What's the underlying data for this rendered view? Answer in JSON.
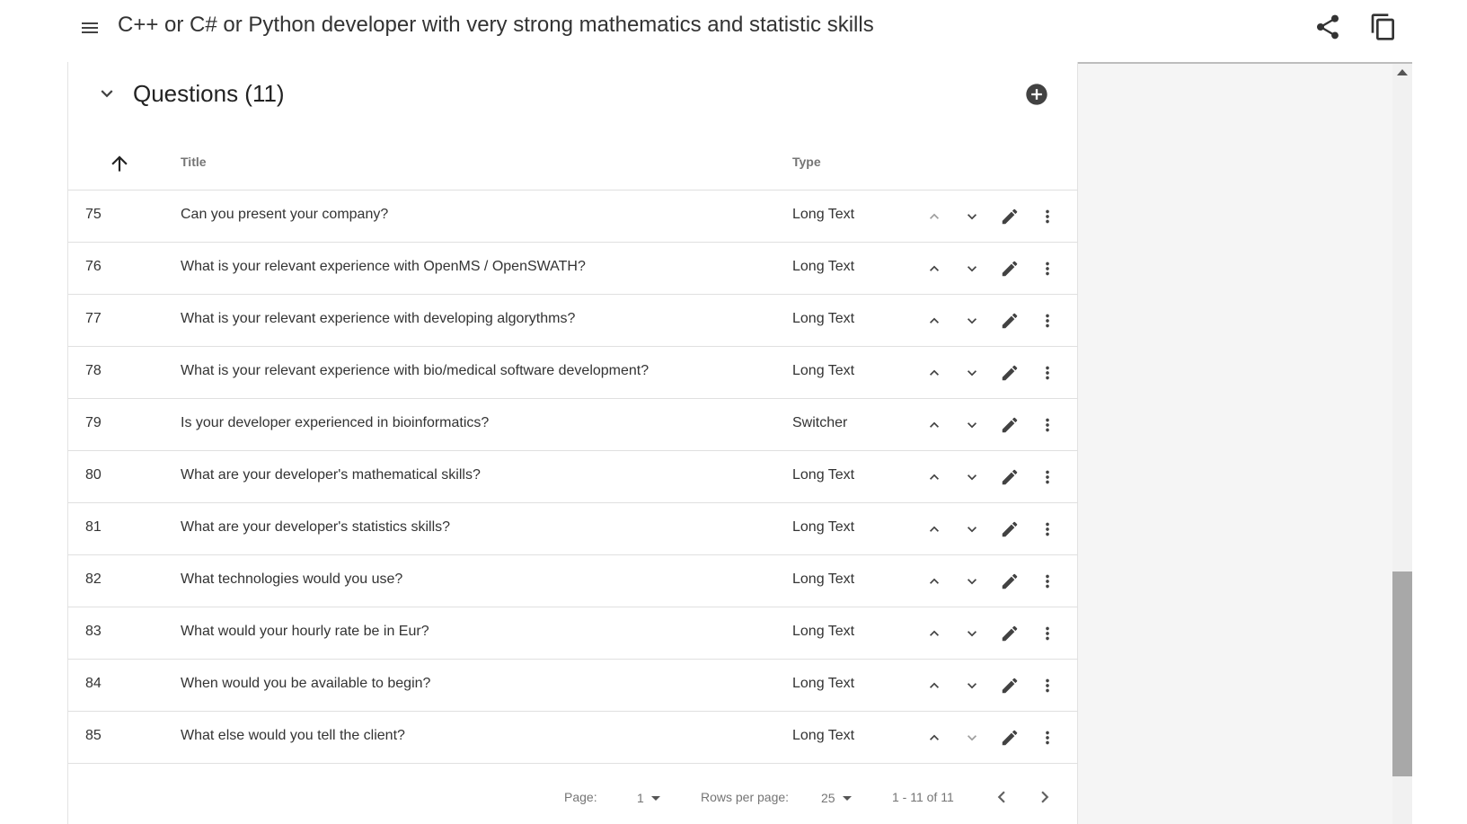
{
  "header": {
    "title": "C++ or C# or Python developer with very strong mathematics and statistic skills",
    "icons": [
      "menu-icon",
      "share-icon",
      "copy-icon"
    ]
  },
  "section": {
    "title": "Questions (11)",
    "columns": {
      "title": "Title",
      "type": "Type"
    }
  },
  "rows": [
    {
      "num": "75",
      "title": "Can you present your company?",
      "type": "Long Text",
      "up_enabled": false
    },
    {
      "num": "76",
      "title": "What is your relevant experience with OpenMS / OpenSWATH?",
      "type": "Long Text",
      "up_enabled": true
    },
    {
      "num": "77",
      "title": "What is your relevant experience with developing algorythms?",
      "type": "Long Text",
      "up_enabled": true
    },
    {
      "num": "78",
      "title": "What is your relevant experience with bio/medical software development?",
      "type": "Long Text",
      "up_enabled": true
    },
    {
      "num": "79",
      "title": "Is your developer experienced in bioinformatics?",
      "type": "Switcher",
      "up_enabled": true
    },
    {
      "num": "80",
      "title": "What are your developer's mathematical skills?",
      "type": "Long Text",
      "up_enabled": true
    },
    {
      "num": "81",
      "title": "What are your developer's statistics skills?",
      "type": "Long Text",
      "up_enabled": true
    },
    {
      "num": "82",
      "title": "What technologies would you use?",
      "type": "Long Text",
      "up_enabled": true
    },
    {
      "num": "83",
      "title": "What would your hourly rate be in Eur?",
      "type": "Long Text",
      "up_enabled": true
    },
    {
      "num": "84",
      "title": "When would you be available to begin?",
      "type": "Long Text",
      "up_enabled": true
    },
    {
      "num": "85",
      "title": "What else would you tell the client?",
      "type": "Long Text",
      "up_enabled": true
    }
  ],
  "pagination": {
    "page_label": "Page:",
    "page_value": "1",
    "rows_label": "Rows per page:",
    "rows_value": "25",
    "range": "1 - 11 of 11"
  },
  "colors": {
    "icon": "#424242",
    "icon_muted": "#9e9e9e",
    "text_muted": "#757575",
    "divider": "#e0e0e0"
  }
}
